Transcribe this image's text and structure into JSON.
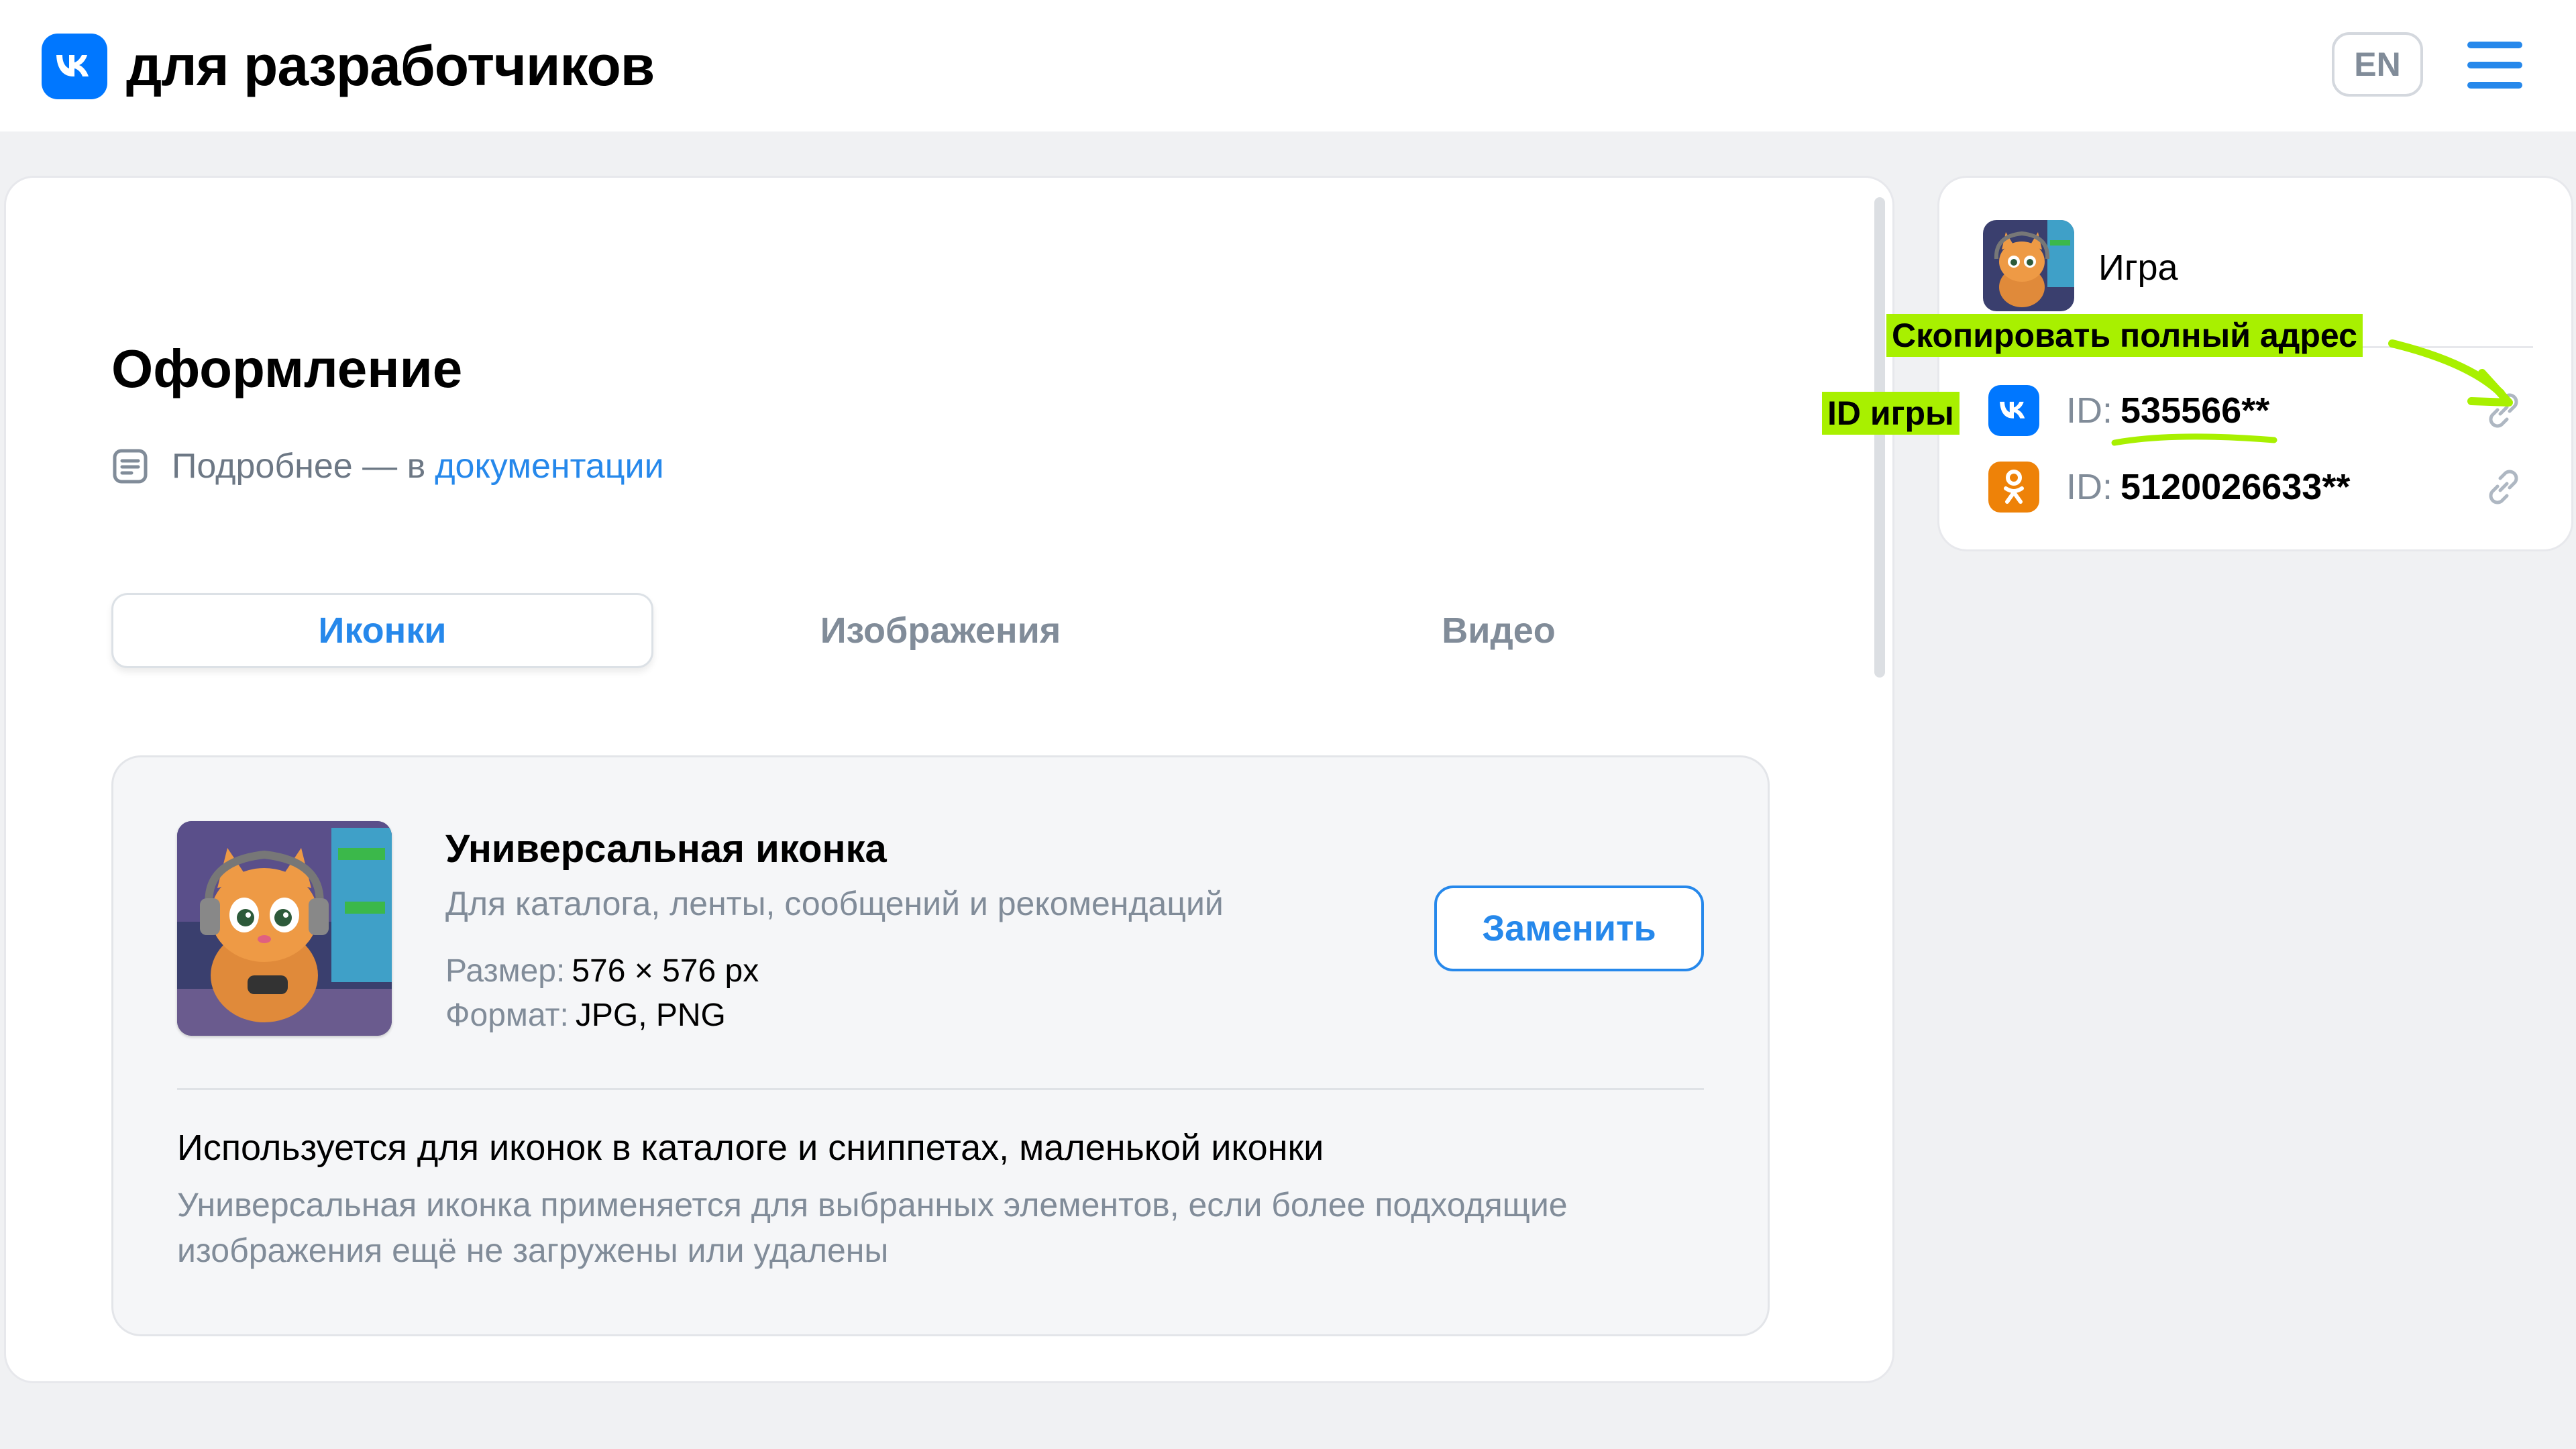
{
  "header": {
    "brand": "для разработчиков",
    "lang_button": "EN"
  },
  "main": {
    "title": "Оформление",
    "doc_prefix": "Подробнее — в",
    "doc_link": "документации",
    "tabs": [
      {
        "label": "Иконки",
        "active": true
      },
      {
        "label": "Изображения",
        "active": false
      },
      {
        "label": "Видео",
        "active": false
      }
    ],
    "icon_card": {
      "title": "Универсальная иконка",
      "subtitle": "Для каталога, ленты, сообщений и рекомендаций",
      "size_label": "Размер:",
      "size_value": "576 × 576 px",
      "format_label": "Формат:",
      "format_value": "JPG, PNG",
      "replace_button": "Заменить",
      "usage_title": "Используется для иконок в каталоге и сниппетах, маленькой иконки",
      "usage_desc": "Универсальная иконка применяется для выбранных элементов, если более подходящие изображения ещё не загружены или удалены"
    }
  },
  "side": {
    "game_name": "Игра",
    "ids": [
      {
        "platform_icon": "vk-icon",
        "label": "ID:",
        "value": "535566**"
      },
      {
        "platform_icon": "ok-icon",
        "label": "ID:",
        "value": "5120026633**"
      }
    ]
  },
  "annotations": {
    "copy_full_address": "Скопировать полный адрес",
    "game_id": "ID игры"
  },
  "colors": {
    "accent": "#2688eb",
    "vk_blue": "#0077ff",
    "ok_orange": "#ee8208",
    "highlight": "#a8f000"
  }
}
